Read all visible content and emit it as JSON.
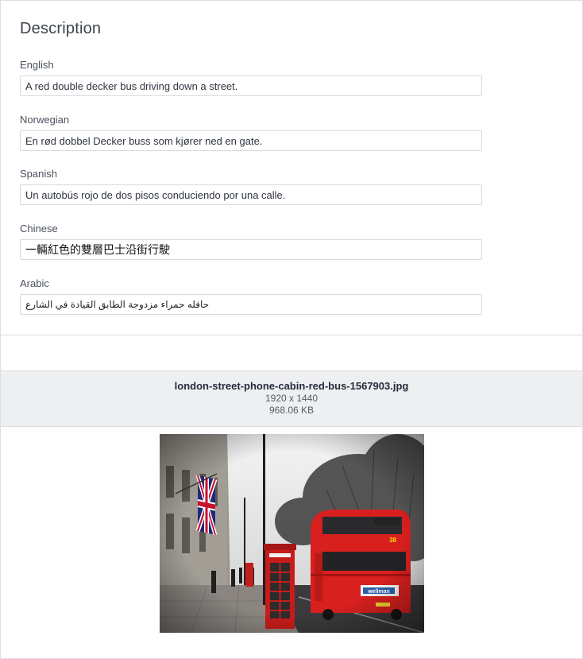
{
  "description": {
    "title": "Description",
    "fields": [
      {
        "label": "English",
        "value": "A red double decker bus driving down a street."
      },
      {
        "label": "Norwegian",
        "value": "En rød dobbel Decker buss som kjører ned en gate."
      },
      {
        "label": "Spanish",
        "value": "Un autobús rojo de dos pisos conduciendo por una calle."
      },
      {
        "label": "Chinese",
        "value": "一輛紅色的雙層巴士沿街行駛"
      },
      {
        "label": "Arabic",
        "value": "حافله حمراء مزدوجة الطابق القيادة في الشارع"
      }
    ]
  },
  "file": {
    "name": "london-street-phone-cabin-red-bus-1567903.jpg",
    "dimensions": "1920 x 1440",
    "size": "968.06 KB"
  },
  "photo": {
    "bus_route_number": "38",
    "bus_ad_text": "wellman"
  },
  "colors": {
    "border": "#dcdde0",
    "band_background": "#eeeff1",
    "bus_red": "#d8201e"
  }
}
